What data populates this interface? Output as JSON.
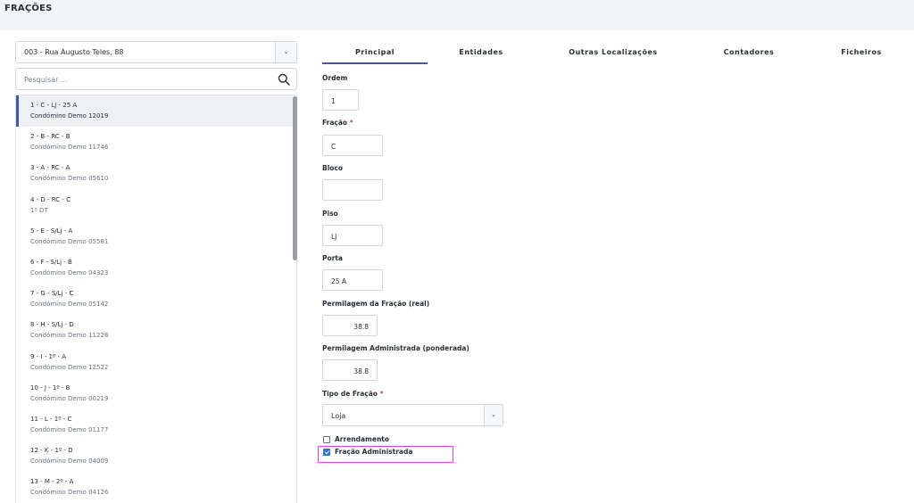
{
  "header": {
    "title": "FRAÇÕES"
  },
  "left": {
    "selected_building": "003 - Rua Augusto Teles, 88",
    "search_placeholder": "Pesquisar ...",
    "items": [
      {
        "title": "1 - C - LJ - 25 A",
        "sub": "Condómino Demo 12019",
        "active": true
      },
      {
        "title": "2 - B - RC - B",
        "sub": "Condómino Demo 11746"
      },
      {
        "title": "3 - A - RC - A",
        "sub": "Condómino Demo 05610"
      },
      {
        "title": "4 - D - RC - C",
        "sub": "1º DT"
      },
      {
        "title": "5 - E - S/Lj - A",
        "sub": "Condómino Demo 05581"
      },
      {
        "title": "6 - F - S/Lj - B",
        "sub": "Condómino Demo 04323"
      },
      {
        "title": "7 - G - S/Lj - C",
        "sub": "Condómino Demo 05142"
      },
      {
        "title": "8 - H - S/Lj - D",
        "sub": "Condómino Demo 11228"
      },
      {
        "title": "9 - I - 1º - A",
        "sub": "Condómino Demo 12522"
      },
      {
        "title": "10 - J - 1º - B",
        "sub": "Condómino Demo 00219"
      },
      {
        "title": "11 - L - 1º - C",
        "sub": "Condómino Demo 01177"
      },
      {
        "title": "12 - K - 1º - D",
        "sub": "Condómino Demo 04009"
      },
      {
        "title": "13 - M - 2º - A",
        "sub": "Condómino Demo 04126"
      }
    ]
  },
  "tabs": [
    "Principal",
    "Entidades",
    "Outras Localizações",
    "Contadores",
    "Ficheiros"
  ],
  "form": {
    "ordem_label": "Ordem",
    "ordem_value": "1",
    "fracao_label": "Fração",
    "fracao_value": "C",
    "bloco_label": "Bloco",
    "bloco_value": "",
    "piso_label": "Piso",
    "piso_value": "LJ",
    "porta_label": "Porta",
    "porta_value": "25 A",
    "perm_real_label": "Permilagem da Fração (real)",
    "perm_real_value": "38.8",
    "perm_adm_label": "Permilagem Administrada (ponderada)",
    "perm_adm_value": "38.8",
    "tipo_label": "Tipo de Fração",
    "tipo_value": "Loja",
    "required_mark": "*",
    "arrendamento_label": "Arrendamento",
    "arrendamento_checked": false,
    "administrada_label": "Fração Administrada",
    "administrada_checked": true
  },
  "icons": {
    "search": "search-icon",
    "dropdown": "chevron-down-icon"
  },
  "colors": {
    "accent": "#3d5aa8",
    "required": "#e0405a",
    "highlight": "#e440e6",
    "checkbox": "#2f6fd6"
  }
}
